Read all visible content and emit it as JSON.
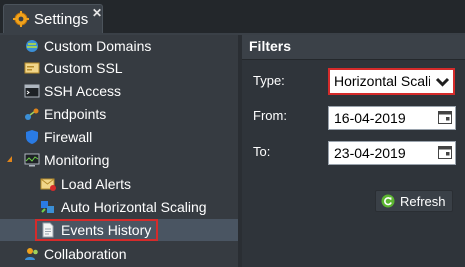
{
  "tab": {
    "title": "Settings",
    "close": "✕",
    "icon": "gear-icon"
  },
  "tree": {
    "items": [
      {
        "label": "Custom Domains",
        "icon": "globe-icon"
      },
      {
        "label": "Custom SSL",
        "icon": "certificate-icon"
      },
      {
        "label": "SSH Access",
        "icon": "terminal-icon"
      },
      {
        "label": "Endpoints",
        "icon": "endpoints-icon"
      },
      {
        "label": "Firewall",
        "icon": "shield-icon"
      },
      {
        "label": "Monitoring",
        "icon": "monitor-icon",
        "expanded": true
      },
      {
        "label": "Load Alerts",
        "icon": "alert-mail-icon"
      },
      {
        "label": "Auto Horizontal Scaling",
        "icon": "scaling-icon"
      },
      {
        "label": "Events History",
        "icon": "document-icon",
        "selected": true
      },
      {
        "label": "Collaboration",
        "icon": "users-icon"
      }
    ]
  },
  "filters": {
    "title": "Filters",
    "type_label": "Type:",
    "type_value": "Horizontal Scaling",
    "from_label": "From:",
    "from_value": "16-04-2019",
    "to_label": "To:",
    "to_value": "23-04-2019",
    "refresh_label": "Refresh"
  },
  "colors": {
    "highlight": "#d52b2b",
    "selected_row": "#4a5562",
    "accent": "#e0851b"
  }
}
